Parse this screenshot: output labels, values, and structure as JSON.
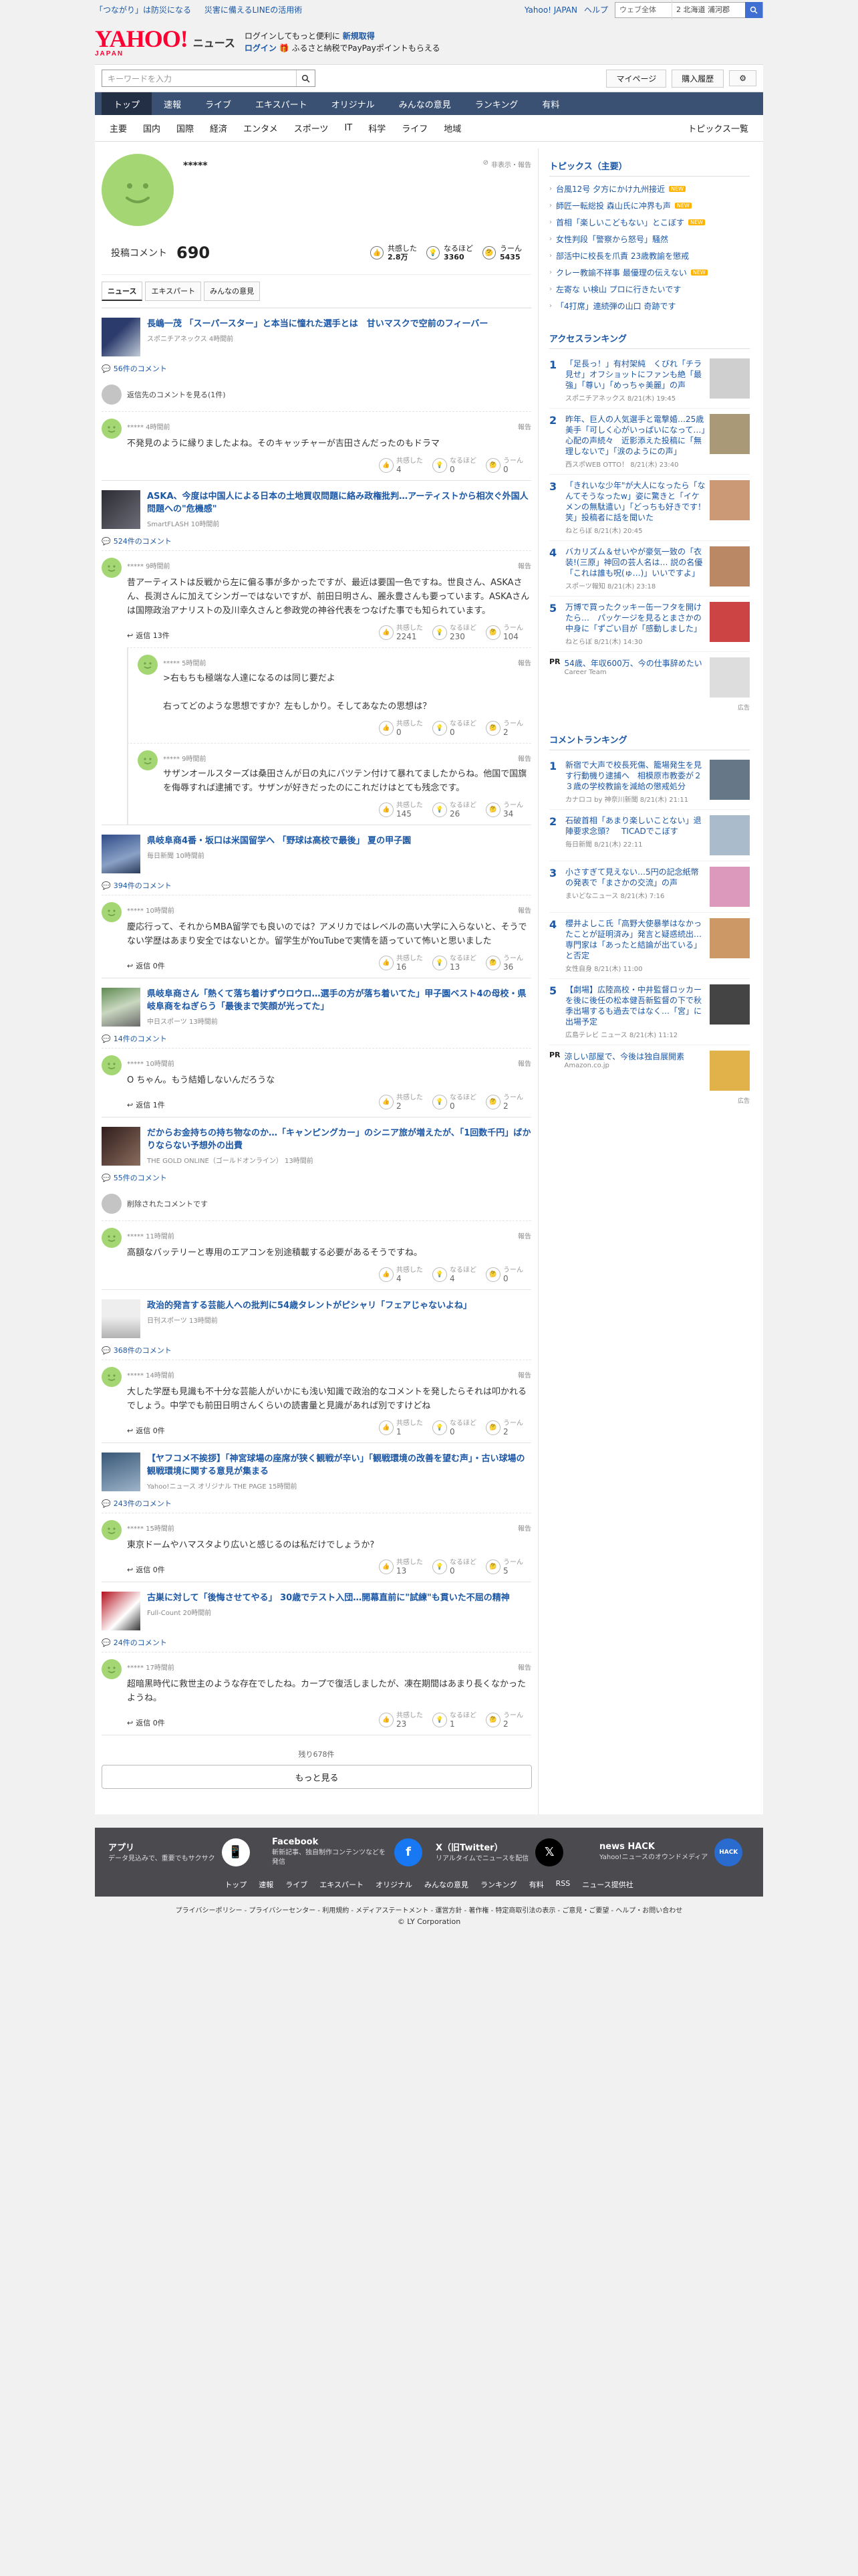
{
  "top_links": {
    "left": [
      "「つながり」は防災になる",
      "災害に備えるLINEの活用術"
    ],
    "right": [
      "Yahoo! JAPAN",
      "ヘルプ"
    ],
    "search_select": "ウェブ全体",
    "weather": "2 北海道 浦河郡"
  },
  "header": {
    "logo": "YAHOO!",
    "logo_sub": "JAPAN",
    "site": "ニュース",
    "promo1": "ログインしてもっと便利に",
    "promo1_b": "新規取得",
    "promo2_b": "ログイン",
    "promo2": "ふるさと納税でPayPayポイントもらえる"
  },
  "searchbar": {
    "placeholder": "キーワードを入力",
    "mypage": "マイページ",
    "history": "購入履歴"
  },
  "global_nav": [
    "トップ",
    "速報",
    "ライブ",
    "エキスパート",
    "オリジナル",
    "みんなの意見",
    "ランキング",
    "有料"
  ],
  "sub_nav": [
    "主要",
    "国内",
    "国際",
    "経済",
    "エンタメ",
    "スポーツ",
    "IT",
    "科学",
    "ライフ",
    "地域"
  ],
  "sub_nav_right": "トピックス一覧",
  "profile": {
    "name": "*****",
    "note": "非表示・報告",
    "post_label": "投稿コメント",
    "post_count": "690",
    "stats": [
      {
        "label": "共感した",
        "value": "2.8万"
      },
      {
        "label": "なるほど",
        "value": "3360"
      },
      {
        "label": "うーん",
        "value": "5435"
      }
    ],
    "tabs": [
      "ニュース",
      "エキスパート",
      "みんなの意見"
    ]
  },
  "articles": [
    {
      "title": "長嶋一茂 「スーパースター」と本当に憧れた選手とは　甘いマスクで空前のフィーバー",
      "source": "スポニチアネックス 4時間前",
      "count": "56件のコメント",
      "pre_note": "返信先のコメントを見る(1件)",
      "comments": [
        {
          "meta": "***** 4時間前",
          "text": "不発見のように縁りましたよね。そのキャッチャーが吉田さんだったのもドラマ",
          "reply": "",
          "r": [
            "4",
            "0",
            "0"
          ]
        }
      ]
    },
    {
      "title": "ASKA、今度は中国人による日本の土地買収問題に絡み政権批判…アーティストから相次ぐ外国人問題への\"危機感\"",
      "source": "SmartFLASH 10時間前",
      "count": "524件のコメント",
      "comments": [
        {
          "meta": "***** 9時間前",
          "text": "昔アーティストは反戦から左に偏る事が多かったですが、最近は要国一色ですね。世良さん、ASKAさん、長渕さんに加えてシンガーではないですが、前田日明さん、麗永豊さんも要っています。ASKAさんは国際政治アナリストの及川幸久さんと参政党の神谷代表をつなげた事でも知られています。",
          "reply": "返信 13件",
          "r": [
            "2241",
            "230",
            "104"
          ]
        },
        {
          "meta": "***** 5時間前",
          "text": ">右もちも極端な人達になるのは同じ要だよ\n\n右ってどのような思想ですか？左もしかり。そしてあなたの思想は？",
          "reply": "",
          "r": [
            "0",
            "0",
            "2"
          ],
          "nested": true
        },
        {
          "meta": "***** 9時間前",
          "text": "サザンオールスターズは桑田さんが日の丸にバツテン付けて暴れてましたからね。他国で国旗を侮辱すれば逮捕です。サザンが好きだったのにこれだけはとても残念です。",
          "reply": "",
          "r": [
            "145",
            "26",
            "34"
          ],
          "nested": true
        }
      ]
    },
    {
      "title": "県岐阜商4番・坂口は米国留学へ 「野球は高校で最後」 夏の甲子園",
      "source": "毎日新聞 10時間前",
      "count": "394件のコメント",
      "comments": [
        {
          "meta": "***** 10時間前",
          "text": "慶応行って、それからMBA留学でも良いのでは？アメリカではレベルの高い大学に入らないと、そうでない学歴はあまり安全ではないとか。留学生がYouTubeで実情を語っていて怖いと思いました",
          "reply": "返信 0件",
          "r": [
            "16",
            "13",
            "36"
          ]
        }
      ]
    },
    {
      "title": "県岐阜商さん「熱くて落ち着けずウロウロ…選手の方が落ち着いてた」甲子園ベスト4の母校・県岐阜商をねぎらう「最後まで笑顔が光ってた」",
      "source": "中日スポーツ 13時間前",
      "count": "14件のコメント",
      "comments": [
        {
          "meta": "***** 10時間前",
          "text": "O ちゃん。もう結婚しないんだろうな",
          "reply": "返信 1件",
          "r": [
            "2",
            "0",
            "2"
          ]
        }
      ]
    },
    {
      "title": "だからお金持ちの持ち物なのか…「キャンピングカー」のシニア旅が増えたが、「1回数千円」ばかりならない予想外の出費",
      "source": "THE GOLD ONLINE（ゴールドオンライン） 13時間前",
      "count": "55件のコメント",
      "pre_note": "削除されたコメントです",
      "comments": [
        {
          "meta": "***** 11時間前",
          "text": "高額なバッテリーと専用のエアコンを別途積載する必要があるそうですね。",
          "reply": "",
          "r": [
            "4",
            "4",
            "0"
          ]
        }
      ]
    },
    {
      "title": "政治的発言する芸能人への批判に54歳タレントがピシャリ「フェアじゃないよね」",
      "source": "日刊スポーツ 13時間前",
      "count": "368件のコメント",
      "comments": [
        {
          "meta": "***** 14時間前",
          "text": "大した学歴も見識も不十分な芸能人がいかにも浅い知識で政治的なコメントを発したらそれは叩かれるでしょう。中学でも前田日明さんくらいの読書量と見識があれば別ですけどね",
          "reply": "返信 0件",
          "r": [
            "1",
            "0",
            "2"
          ]
        }
      ]
    },
    {
      "title": "【ヤフコメ不挨拶】「神宮球場の座席が狭く観戦が辛い」「観戦環境の改善を望む声」・古い球場の観戦環境に関する意見が集まる",
      "source": "Yahoo!ニュース オリジナル THE PAGE 15時間前",
      "count": "243件のコメント",
      "comments": [
        {
          "meta": "***** 15時間前",
          "text": "東京ドームやハマスタより広いと感じるのは私だけでしょうか?",
          "reply": "返信 0件",
          "r": [
            "13",
            "0",
            "5"
          ]
        }
      ]
    },
    {
      "title": "古巣に対して「後悔させてやる」 30歳でテスト入団…開幕直前に\"試練\"も貫いた不屈の精神",
      "source": "Full-Count 20時間前",
      "count": "24件のコメント",
      "comments": [
        {
          "meta": "***** 17時間前",
          "text": "超暗黒時代に救世主のような存在でしたね。カープで復活しましたが、凍在期間はあまり長くなかったようね。",
          "reply": "返信 0件",
          "r": [
            "23",
            "1",
            "2"
          ]
        }
      ]
    }
  ],
  "more": {
    "rest": "残り678件",
    "button": "もっと見る"
  },
  "reaction_labels": [
    "共感した",
    "なるほど",
    "うーん"
  ],
  "sidebar": {
    "topics_title": "トピックス（主要）",
    "topics": [
      {
        "t": "台風12号 夕方にかけ九州接近",
        "new": true
      },
      {
        "t": "師匠一転総投 森山氏に冲界も声",
        "new": true
      },
      {
        "t": "首相「楽しいこどもない」とこぼす",
        "new": true
      },
      {
        "t": "女性判段「警察から怒号」騒然",
        "new": false
      },
      {
        "t": "部活中に校長を爪責 23歳教諭を懲戒",
        "new": false
      },
      {
        "t": "クレー教諭不祥事 最優理の伝えない",
        "new": true
      },
      {
        "t": "左寄な い検山 プロに行きたいです",
        "new": false
      },
      {
        "t": "「4打席」連続弾の山口 奇跡です",
        "new": false
      }
    ],
    "access_title": "アクセスランキング",
    "access": [
      {
        "t": "「足長っ！」有村架純　くびれ「チラ見せ」オフショットにファンも絶「最強」「尊い」「めっちゃ美麗」の声",
        "s": "スポニチアネックス 8/21(木) 19:45"
      },
      {
        "t": "昨年、巨人の人気選手と電撃婚…25歳美手「可しく心がいっぱいになって…」心配の声続々　近影添えた投稿に「無理しないで」「涙のようにの声」",
        "s": "西スポWEB OTTO！ 8/21(木) 23:40"
      },
      {
        "t": "「きれいな少年\"が大人になったら「なんてそうなったw」姿に驚きと「イケメンの無駄遣い」「どっちも好きです！笑」投稿者に話を聞いた",
        "s": "ねとらぼ 8/21(木) 20:45"
      },
      {
        "t": "バカリズム＆せいやが豪気一致の「衣装!(三原」神回の芸人名は… 説の名優「これは誰も呪(ゅ…)」いいですよ」",
        "s": "スポーツ報知 8/21(木) 23:18"
      },
      {
        "t": "万博で買ったクッキー缶一フタを開けたら…　パッケージを見るとまさかの中身に「ずごい目が「感動しました」",
        "s": "ねとらぼ 8/21(木) 14:30"
      }
    ],
    "ad1": {
      "pr": "PR",
      "t": "54歳、年収600万、今の仕事辞めたい",
      "s": "Career Team"
    },
    "comment_title": "コメントランキング",
    "comment_rank": [
      {
        "t": "新宿で大声で校長死傷、籠場発生を見す行動機り逮捕へ　相模原市教委が２３歳の学校教諭を減給の懲戒処分",
        "s": "カナロコ by 神奈川新聞 8/21(木) 21:11"
      },
      {
        "t": "石破首相「あまり楽しいことない」退陣要求念頭？　TICADでこぼす",
        "s": "毎日新聞 8/21(木) 22:11"
      },
      {
        "t": "小さすぎて見えない…5円の記念紙幣の発表で「まさかの交流」の声",
        "s": "まいどなニュース 8/21(木) 7:16"
      },
      {
        "t": "櫻井よしこ氏「高野大使暴挙はなかったことが証明済み」発言と疑惑続出…専門家は「あったと結論が出ている」と否定",
        "s": "女性自身 8/21(木) 11:00"
      },
      {
        "t": "【劇場】広陸高校・中井監督ロッカーを後に後任の松本健吾新監督の下で秋季出場するも過去ではなく…「宮」に出場予定",
        "s": "広島テレビ ニュース 8/21(木) 11:12"
      }
    ],
    "ad2": {
      "pr": "PR",
      "t": "涼しい部屋で、今後は独自展開素",
      "s": "Amazon.co.jp"
    },
    "ad_meta": "広告"
  },
  "footer": {
    "apps": [
      {
        "t": "アプリ",
        "d": "データ見込みで、重要でもサクサク"
      },
      {
        "t": "Facebook",
        "d": "斬新記事、独自制作コンテンツなどを発信"
      },
      {
        "t": "X（旧Twitter）",
        "d": "リアルタイムでニュースを配信"
      },
      {
        "t": "news HACK",
        "d": "Yahoo!ニュースのオウンドメディア"
      }
    ],
    "links": [
      "トップ",
      "速報",
      "ライブ",
      "エキスパート",
      "オリジナル",
      "みんなの意見",
      "ランキング",
      "有料",
      "RSS",
      "ニュース提供社"
    ],
    "legal": "プライバシーポリシー - プライバシーセンター - 利用規約 - メディアステートメント - 運営方針 - 著作権 - 特定商取引法の表示 - ご意見・ご要望 - ヘルプ・お問い合わせ",
    "copyright": "© LY Corporation"
  }
}
